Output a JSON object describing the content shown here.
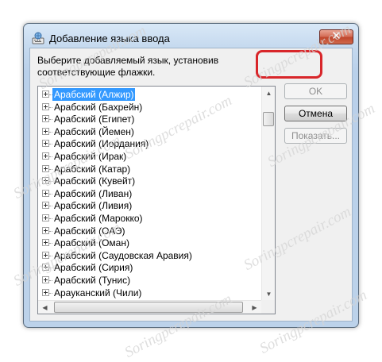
{
  "window": {
    "title": "Добавление языка ввода",
    "close_label": "✕"
  },
  "instruction": "Выберите добавляемый язык, установив\nсоответствующие флажки.",
  "languages": [
    "Арабский (Алжир)",
    "Арабский (Бахрейн)",
    "Арабский (Египет)",
    "Арабский (Йемен)",
    "Арабский (Иордания)",
    "Арабский (Ирак)",
    "Арабский (Катар)",
    "Арабский (Кувейт)",
    "Арабский (Ливан)",
    "Арабский (Ливия)",
    "Арабский (Марокко)",
    "Арабский (ОАЭ)",
    "Арабский (Оман)",
    "Арабский (Саудовская Аравия)",
    "Арабский (Сирия)",
    "Арабский (Тунис)",
    "Арауканский (Чили)"
  ],
  "selected_index": 0,
  "buttons": {
    "ok": "OK",
    "cancel": "Отмена",
    "show": "Показать..."
  },
  "watermark": "Soringpcrepair.com",
  "colors": {
    "selection": "#3399ff",
    "highlight": "#d8262a"
  }
}
